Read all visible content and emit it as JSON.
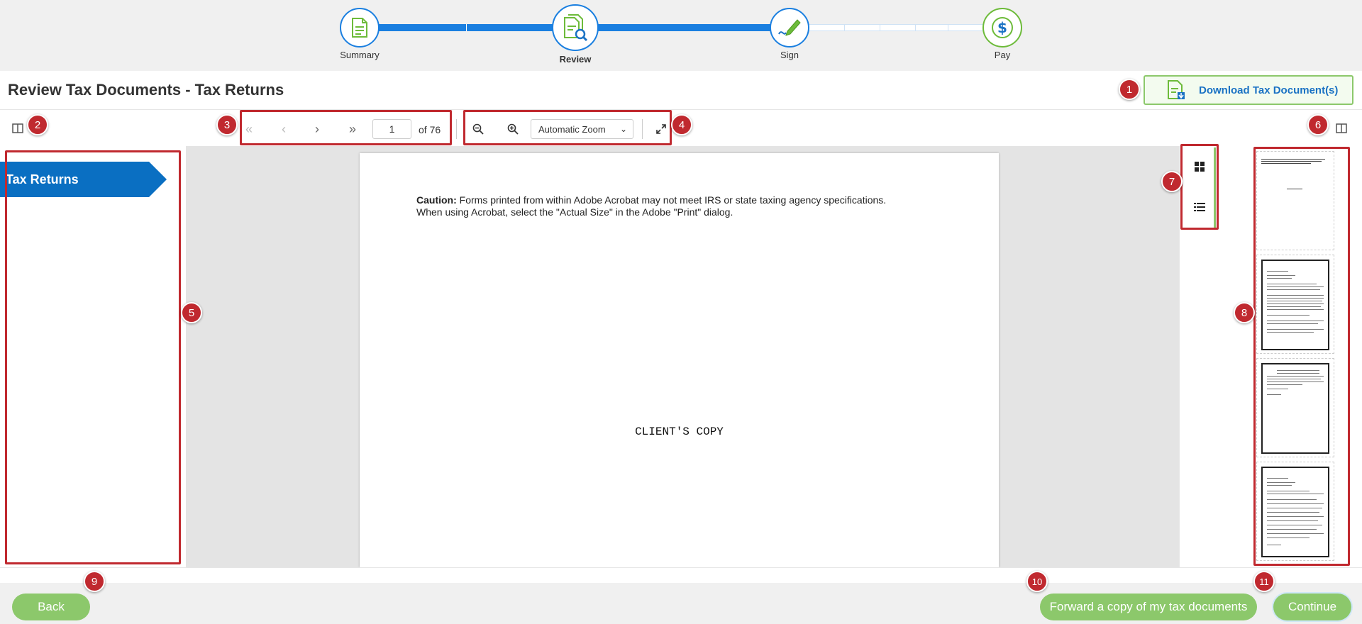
{
  "stepper": {
    "steps": [
      {
        "label": "Summary",
        "icon": "document-icon"
      },
      {
        "label": "Review",
        "icon": "document-search-icon"
      },
      {
        "label": "Sign",
        "icon": "pen-icon"
      },
      {
        "label": "Pay",
        "icon": "dollar-icon"
      }
    ],
    "active_step": "Review",
    "colors": {
      "progress": "#1a7fe0",
      "icon_green": "#6dbb3a"
    }
  },
  "header": {
    "title": "Review Tax Documents - Tax Returns",
    "download_label": "Download Tax Document(s)"
  },
  "toolbar": {
    "page_value": "1",
    "page_total": "of 76",
    "zoom_value": "Automatic Zoom"
  },
  "sidebar": {
    "items": [
      {
        "label": "Tax Returns"
      }
    ]
  },
  "document": {
    "caution_bold": "Caution:",
    "caution_line1": "Forms printed from within Adobe Acrobat may not meet IRS or state taxing agency specifications.",
    "caution_line2": "When using Acrobat, select the \"Actual Size\" in the Adobe \"Print\" dialog.",
    "client_copy": "CLIENT'S COPY"
  },
  "thumbnails": {
    "count_visible": 4
  },
  "footer": {
    "back_label": "Back",
    "forward_label": "Forward a copy of my tax documents",
    "continue_label": "Continue"
  },
  "annotations": [
    "1",
    "2",
    "3",
    "4",
    "5",
    "6",
    "7",
    "8",
    "9",
    "10",
    "11"
  ],
  "colors": {
    "accent_green": "#8cc86b",
    "tab_blue": "#0a6fc2",
    "annotation_red": "#c0292f"
  }
}
